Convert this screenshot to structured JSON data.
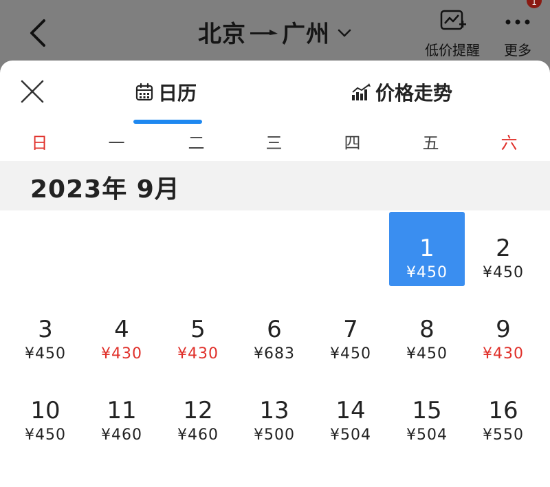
{
  "header": {
    "from_city": "北京",
    "to_city": "广州",
    "price_alert_label": "低价提醒",
    "more_label": "更多",
    "notification_badge": "1"
  },
  "tabs": [
    {
      "label": "日历",
      "active": true
    },
    {
      "label": "价格走势",
      "active": false
    }
  ],
  "weekdays": [
    "日",
    "一",
    "二",
    "三",
    "四",
    "五",
    "六"
  ],
  "month_title": "2023年 9月",
  "days": [
    {
      "day": "1",
      "price": "¥450",
      "selected": true,
      "low": false
    },
    {
      "day": "2",
      "price": "¥450",
      "selected": false,
      "low": false
    },
    {
      "day": "3",
      "price": "¥450",
      "selected": false,
      "low": false
    },
    {
      "day": "4",
      "price": "¥430",
      "selected": false,
      "low": true
    },
    {
      "day": "5",
      "price": "¥430",
      "selected": false,
      "low": true
    },
    {
      "day": "6",
      "price": "¥683",
      "selected": false,
      "low": false
    },
    {
      "day": "7",
      "price": "¥450",
      "selected": false,
      "low": false
    },
    {
      "day": "8",
      "price": "¥450",
      "selected": false,
      "low": false
    },
    {
      "day": "9",
      "price": "¥430",
      "selected": false,
      "low": true
    },
    {
      "day": "10",
      "price": "¥450",
      "selected": false,
      "low": false
    },
    {
      "day": "11",
      "price": "¥460",
      "selected": false,
      "low": false
    },
    {
      "day": "12",
      "price": "¥460",
      "selected": false,
      "low": false
    },
    {
      "day": "13",
      "price": "¥500",
      "selected": false,
      "low": false
    },
    {
      "day": "14",
      "price": "¥504",
      "selected": false,
      "low": false
    },
    {
      "day": "15",
      "price": "¥504",
      "selected": false,
      "low": false
    },
    {
      "day": "16",
      "price": "¥550",
      "selected": false,
      "low": false
    }
  ],
  "colors": {
    "accent": "#1e88f0",
    "selected_bg": "#3a8ef0",
    "low_price": "#e0302a",
    "weekend": "#e0302a"
  },
  "icons": {
    "back": "chevron-left-icon",
    "route_arrow": "arrow-right-icon",
    "dropdown": "chevron-down-icon",
    "price_alert": "chart-bell-icon",
    "more": "ellipsis-icon",
    "close": "close-icon",
    "calendar": "calendar-icon",
    "trend": "bar-chart-icon"
  }
}
